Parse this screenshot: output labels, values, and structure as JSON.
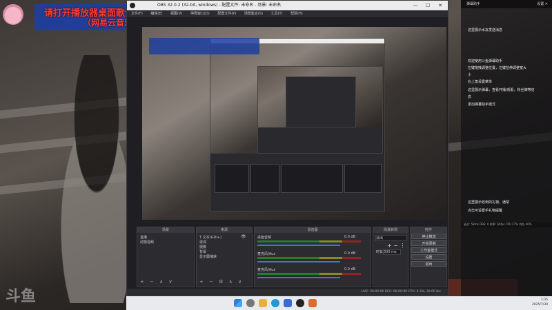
{
  "lyrics": {
    "line1": "请打开播放器桌面歌词",
    "line2": "（网易云音乐、酷狗或者QQ音乐）"
  },
  "obs": {
    "title": "OBS 32.0.2 (32-bit, windows) - 配置文件: 未命名 - 场景: 未命名",
    "window_controls": [
      "—",
      "☐",
      "✕"
    ],
    "menu": [
      "文件(F)",
      "编辑(E)",
      "视图(V)",
      "停靠窗口(D)",
      "配置文件(P)",
      "场景集合(S)",
      "工具(T)",
      "帮助(H)"
    ],
    "scenes": {
      "header": "场景",
      "items": [
        "直播",
        "动物视频"
      ]
    },
    "sources": {
      "header": "来源",
      "items": [
        "T 文本(GDI+)",
        "歌词",
        "摄像",
        "背景",
        "显示器捕获"
      ]
    },
    "mixer": {
      "header": "混音器",
      "tracks": [
        {
          "name": "桌面音频",
          "level": "0.0 dB"
        },
        {
          "name": "麦克风/Aux",
          "level": "0.0 dB"
        },
        {
          "name": "麦克风/Aux",
          "level": "0.0 dB"
        }
      ]
    },
    "transitions": {
      "header": "场景转场",
      "type": "淡出",
      "duration_label": "时长",
      "duration_value": "300 ms"
    },
    "controls": {
      "header": "控件",
      "buttons": [
        "停止推流",
        "开始录制",
        "工作室模式",
        "设置",
        "退出"
      ]
    },
    "statusbar": "LIVE: 00:00:00    REC: 00:00:00    CPU: 0.3%, 30.00 fps"
  },
  "right_panel": {
    "top_left": "弹幕助手",
    "top_right": "设置 ✕",
    "lines": [
      "这里展示水友发送消息",
      "欢迎使用斗鱼弹幕助手",
      "左键拖拽调整位置，左键拉伸调整宽大",
      "小",
      "右上角设置菜单",
      "这里展示弹幕，查看开播/观看，粉丝牌等信",
      "息",
      "添加弹幕助手模式"
    ],
    "bottom_lines": [
      "这里展示收到的礼物，通常",
      "点击可设置手礼物提醒"
    ],
    "status": "延迟: 58ms  OBS: 0  帧率: 60fps   CPU 27%  内存 40%"
  },
  "taskbar": {
    "time": "1:35",
    "date": "2025/7/30"
  },
  "watermark": "斗鱼"
}
